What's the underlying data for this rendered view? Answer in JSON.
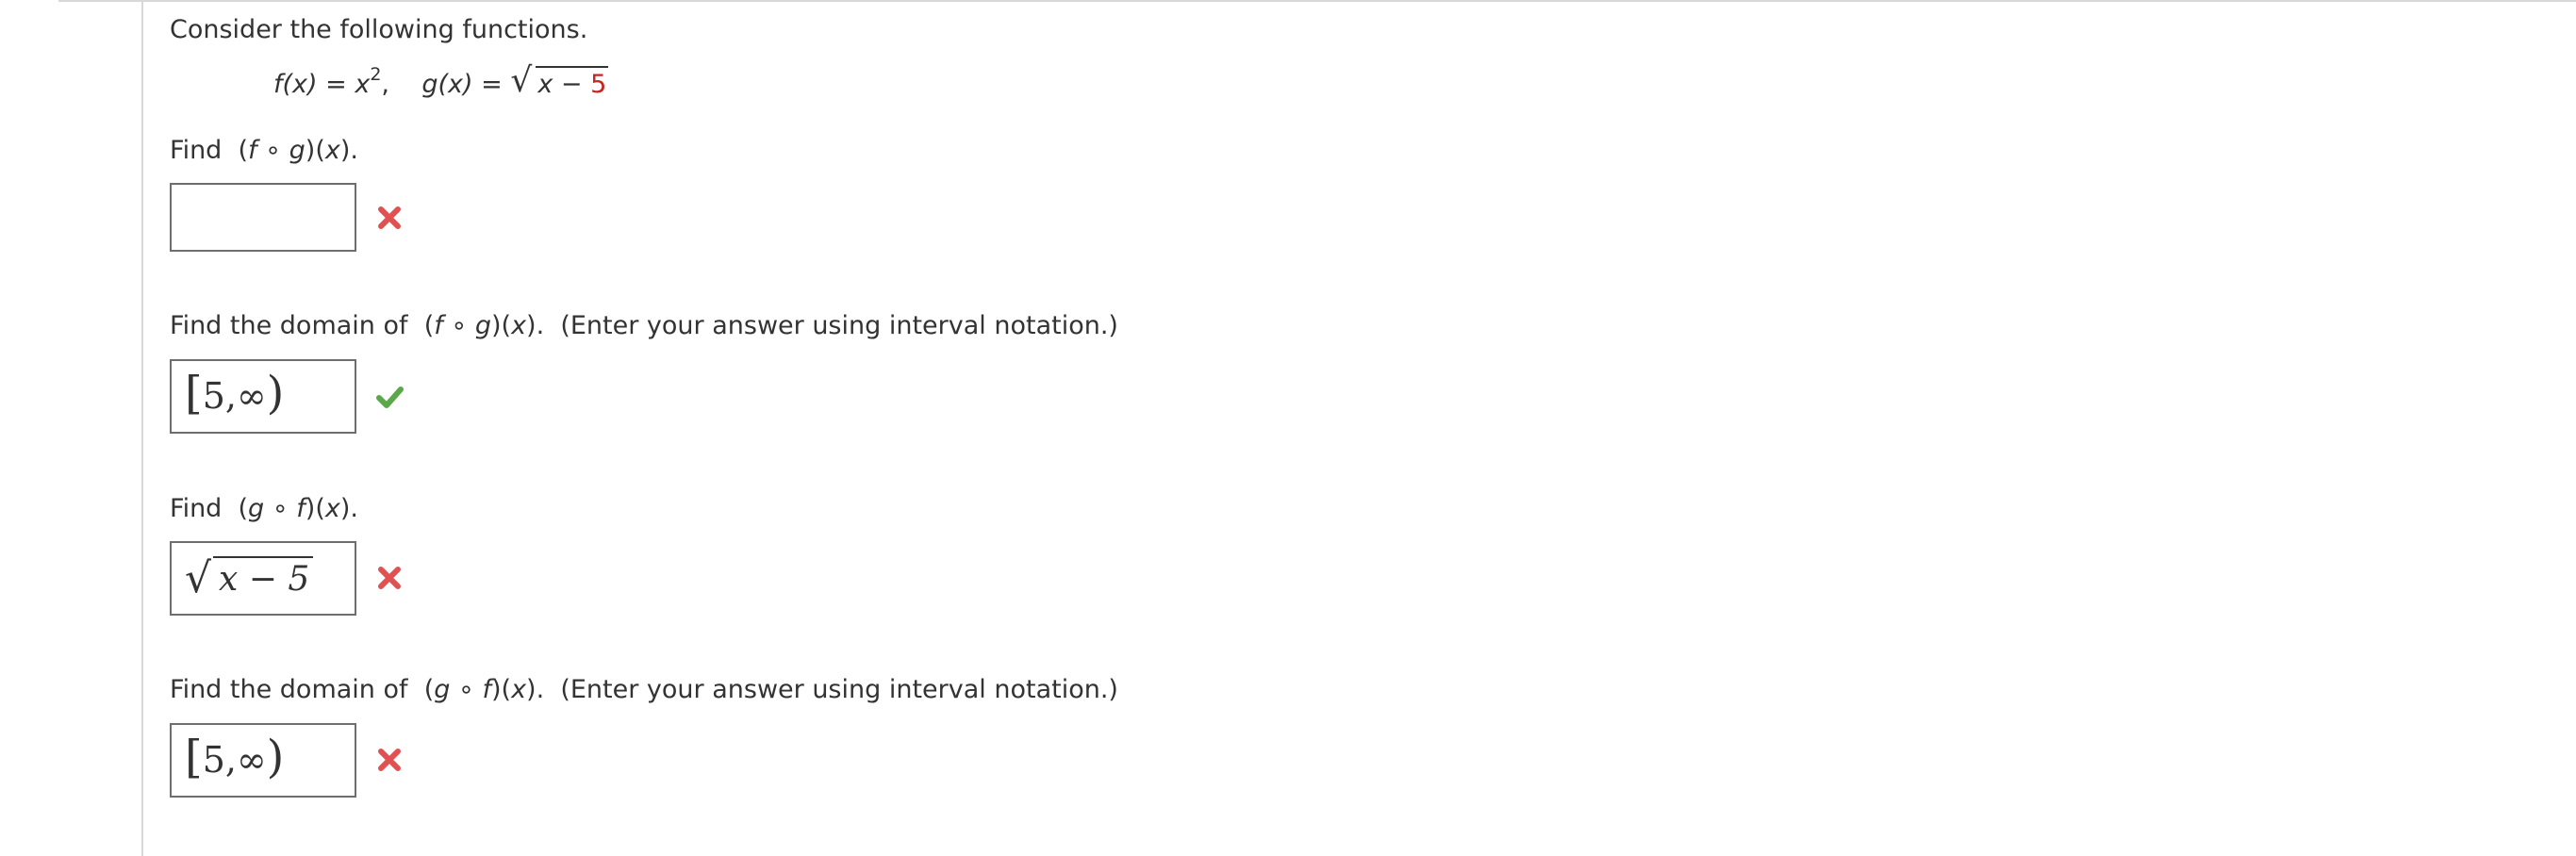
{
  "prompt": {
    "intro": "Consider the following functions.",
    "f_def": "f(x) = x",
    "f_exp": "2",
    "sep": ",",
    "g_def": "g(x) = ",
    "g_radicand": "x − ",
    "g_radicand_red": "5"
  },
  "q1": {
    "find": "Find",
    "expr_open": "(",
    "f": "f",
    "comp": " ∘ ",
    "g": "g",
    "expr_close": ")(",
    "x": "x",
    "end": ").",
    "answer": "",
    "status": "incorrect"
  },
  "q2": {
    "prefix": "Find the domain of",
    "expr_open": "(",
    "f": "f",
    "comp": " ∘ ",
    "g": "g",
    "expr_close": ")(",
    "x": "x",
    "end": ").",
    "note": "(Enter your answer using interval notation.)",
    "answer_left": "[",
    "answer_value": "5,∞",
    "answer_right": ")",
    "status": "correct"
  },
  "q3": {
    "find": "Find",
    "expr_open": "(",
    "g": "g",
    "comp": " ∘ ",
    "f": "f",
    "expr_close": ")(",
    "x": "x",
    "end": ").",
    "answer_radicand": "x − 5",
    "status": "incorrect"
  },
  "q4": {
    "prefix": "Find the domain of",
    "expr_open": "(",
    "g": "g",
    "comp": " ∘ ",
    "f": "f",
    "expr_close": ")(",
    "x": "x",
    "end": ").",
    "note": "(Enter your answer using interval notation.)",
    "answer_left": "[",
    "answer_value": "5,∞",
    "answer_right": ")",
    "status": "incorrect"
  },
  "colors": {
    "incorrect": "#e05252",
    "correct": "#5ba84a",
    "highlight": "#c8231f"
  },
  "icons": {
    "incorrect": "x-mark-icon",
    "correct": "check-mark-icon"
  }
}
